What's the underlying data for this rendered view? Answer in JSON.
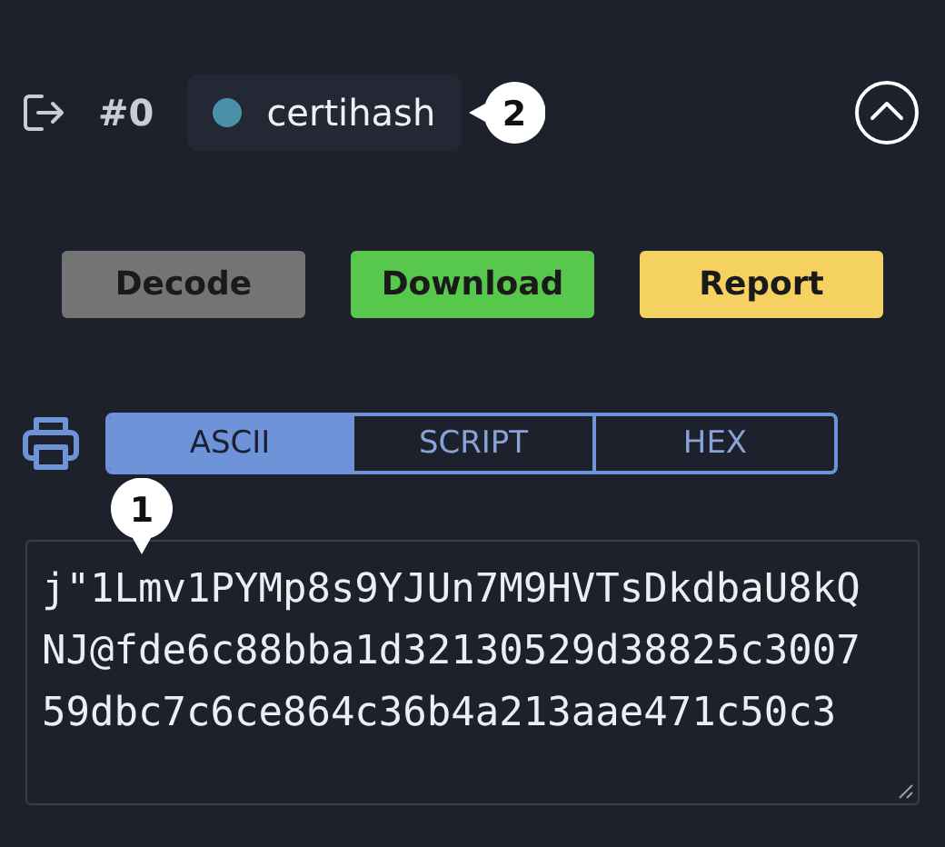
{
  "header": {
    "index": "#0",
    "tag": {
      "label": "certihash",
      "color": "#4a90a8"
    }
  },
  "actions": [
    {
      "label": "Decode",
      "kind": "neutral"
    },
    {
      "label": "Download",
      "kind": "success"
    },
    {
      "label": "Report",
      "kind": "warning"
    }
  ],
  "tabs": [
    {
      "label": "ASCII",
      "selected": true
    },
    {
      "label": "SCRIPT",
      "selected": false
    },
    {
      "label": "HEX",
      "selected": false
    }
  ],
  "output": {
    "value": "j\"1Lmv1PYMp8s9YJUn7M9HVTsDkdbaU8kQNJ@fde6c88bba1d32130529d38825c300759dbc7c6ce864c36b4a213aae471c50c3"
  },
  "callouts": [
    {
      "label": "2"
    },
    {
      "label": "1"
    }
  ]
}
